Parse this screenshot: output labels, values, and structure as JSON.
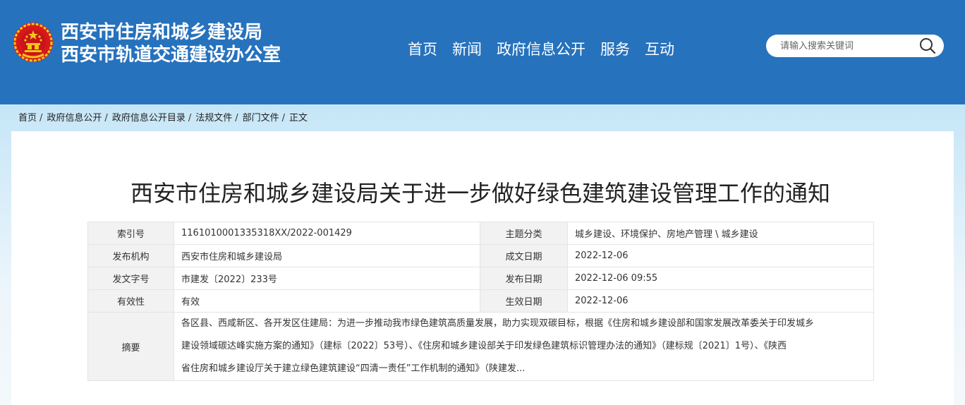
{
  "header": {
    "site_name_line1": "西安市住房和城乡建设局",
    "site_name_line2": "西安市轨道交通建设办公室",
    "nav": [
      "首页",
      "新闻",
      "政府信息公开",
      "服务",
      "互动"
    ],
    "search_placeholder": "请输入搜索关键词",
    "colors": {
      "header_bg": "#2672bd",
      "emblem_red": "#d7191c",
      "emblem_gold": "#f5c518"
    }
  },
  "breadcrumb": {
    "items": [
      "首页",
      "政府信息公开",
      "政府信息公开目录",
      "法规文件",
      "部门文件"
    ],
    "current": "正文",
    "separator": "/"
  },
  "article": {
    "title": "西安市住房和城乡建设局关于进一步做好绿色建筑建设管理工作的通知"
  },
  "meta": {
    "index_no_label": "索引号",
    "index_no": "1161010001335318XX/2022-001429",
    "category_label": "主题分类",
    "category": "城乡建设、环境保护、房地产管理 \\ 城乡建设",
    "publisher_label": "发布机构",
    "publisher": "西安市住房和城乡建设局",
    "written_date_label": "成文日期",
    "written_date": "2022-12-06",
    "doc_no_label": "发文字号",
    "doc_no": "市建发〔2022〕233号",
    "publish_date_label": "发布日期",
    "publish_date": "2022-12-06 09:55",
    "validity_label": "有效性",
    "validity": "有效",
    "effective_date_label": "生效日期",
    "effective_date": "2022-12-06",
    "summary_label": "摘要",
    "summary_line1": "各区县、西咸新区、各开发区住建局：为进一步推动我市绿色建筑高质量发展，助力实现双碳目标，根据《住房和城乡建设部和国家发展改革委关于印发城乡",
    "summary_line2": "建设领域碳达峰实施方案的通知》（建标〔2022〕53号）、《住房和城乡建设部关于印发绿色建筑标识管理办法的通知》（建标规〔2021〕1号）、《陕西",
    "summary_line3": "省住房和城乡建设厅关于建立绿色建筑建设“四清一责任”工作机制的通知》（陕建发..."
  }
}
